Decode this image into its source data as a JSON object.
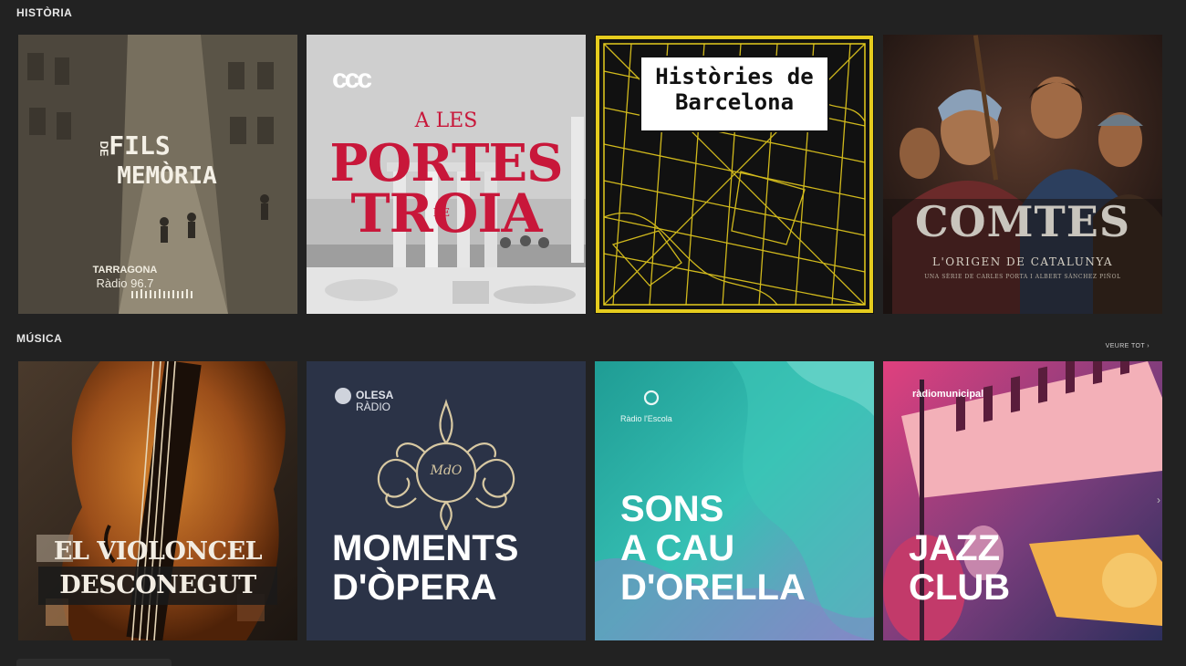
{
  "sections": {
    "history": {
      "title": "HISTÒRIA",
      "cards": [
        {
          "line1": "FILS",
          "mid": "DE",
          "line2": "MEMÒRIA",
          "station": "TARRAGONA",
          "station2": "Ràdio 96.7"
        },
        {
          "logo": "ccc",
          "pre": "A LES",
          "line1": "PORTES",
          "mid": "DE",
          "line2": "TROIA"
        },
        {
          "line1": "Històries de",
          "line2": "Barcelona"
        },
        {
          "line1": "COMTES",
          "subtitle": "L'ORIGEN DE CATALUNYA",
          "credit": "UNA SÈRIE DE CARLES PORTA I ALBERT SÀNCHEZ PIÑOL"
        }
      ]
    },
    "music": {
      "title": "MÚSICA",
      "see_all": "VEURE TOT",
      "cards": [
        {
          "line1": "EL VIOLONCEL",
          "line2": "DESCONEGUT"
        },
        {
          "station": "OLESA",
          "station2": "RÀDIO",
          "monogram": "MdO",
          "line1": "MOMENTS",
          "line2": "D'ÒPERA"
        },
        {
          "station": "Ràdio l'Escola",
          "line1": "SONS",
          "line2": "A CAU",
          "line3": "D'ORELLA"
        },
        {
          "station": "ràdiomunicipal",
          "line1": "JAZZ",
          "line2": "CLUB"
        }
      ]
    }
  },
  "colors": {
    "background": "#222222",
    "troia_red": "#c8173a",
    "map_yellow": "#e6cc1e",
    "opera_navy": "#2b3347",
    "teal": "#27b2a8",
    "jazz_pink": "#e0407e"
  }
}
